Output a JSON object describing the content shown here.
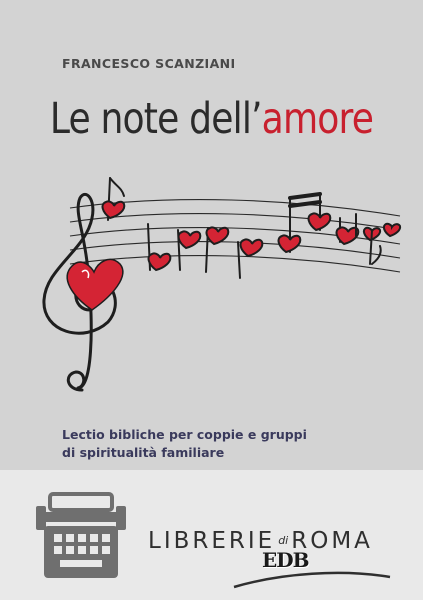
{
  "cover": {
    "author": "FRANCESCO SCANZIANI",
    "title_main": "Le note dell’",
    "title_accent": "amore",
    "subtitle_line1": "Lectio bibliche per coppie e gruppi",
    "subtitle_line2": "di spiritualità familiare",
    "accent_color": "#c8202e"
  },
  "banner": {
    "store_name_part1": "LIBRERIE",
    "store_name_connector": "di",
    "store_name_part2": "ROMA",
    "publisher_logo": "EDB",
    "icon": "typewriter-icon"
  }
}
